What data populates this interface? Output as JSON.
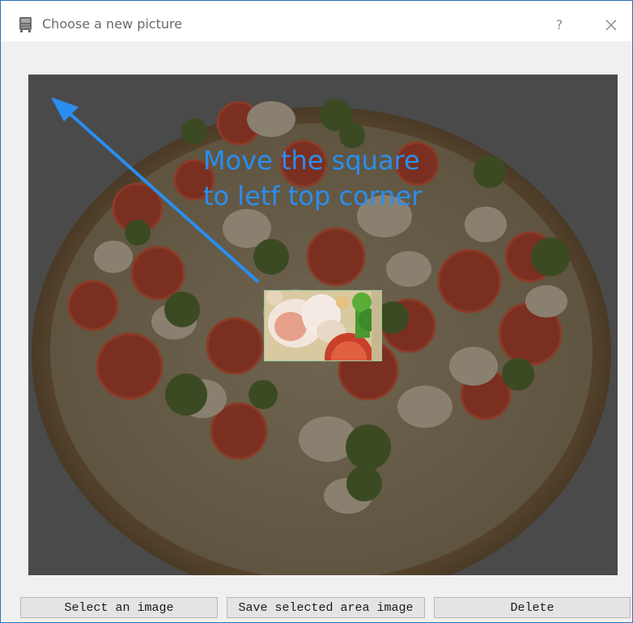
{
  "window": {
    "title": "Choose a new picture",
    "help_label": "?",
    "close_icon": "close-icon",
    "app_icon": "app-icon"
  },
  "canvas": {
    "annotation": {
      "line1": "Move the square",
      "line2": "to letf top corner",
      "color": "#2a8ef0"
    },
    "arrow_icon": "arrow-icon",
    "image": "pizza-image",
    "overlay_color": "#4a4a4a"
  },
  "buttons": {
    "select_label": "Select an image",
    "save_label": "Save selected area image",
    "delete_label": "Delete"
  }
}
